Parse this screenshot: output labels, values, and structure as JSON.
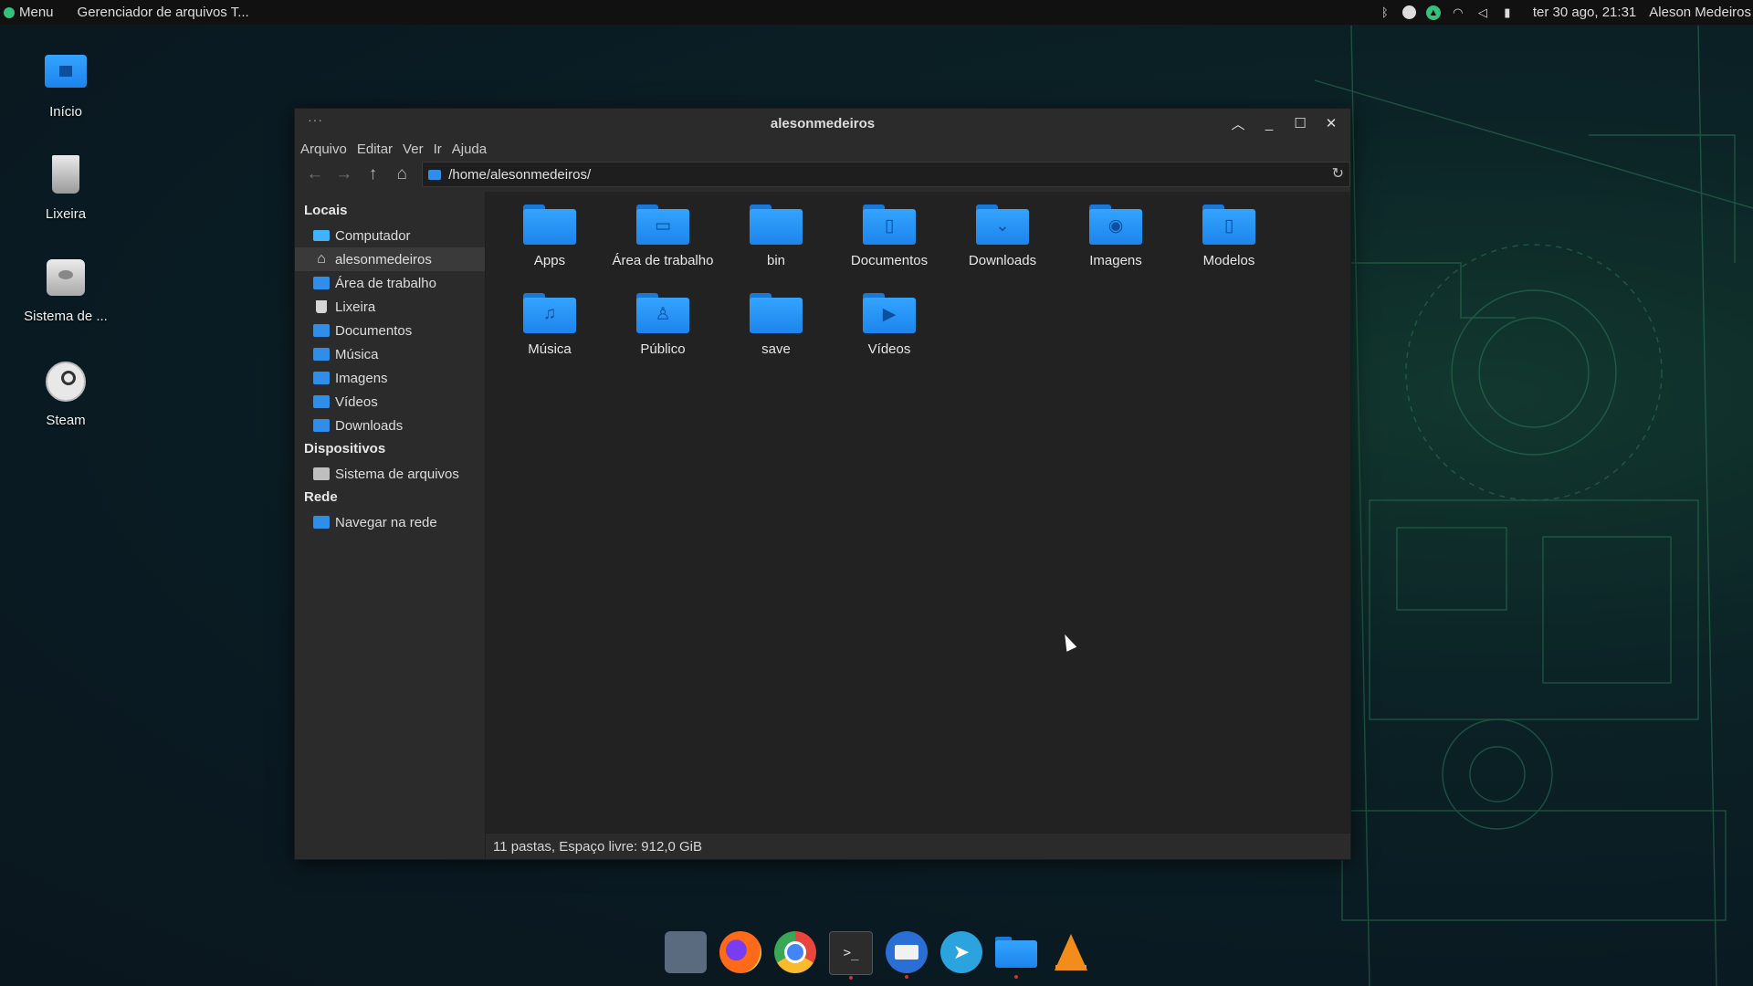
{
  "top_panel": {
    "menu_label": "Menu",
    "task_label": "Gerenciador de arquivos T...",
    "clock": "ter 30 ago, 21:31",
    "user": "Aleson Medeiros",
    "tray_icons": [
      "bluetooth-icon",
      "steam-tray-icon",
      "update-icon",
      "wifi-icon",
      "volume-icon",
      "battery-icon"
    ]
  },
  "desktop": {
    "icons": [
      {
        "label": "Início",
        "icon": "home-folder-icon"
      },
      {
        "label": "Lixeira",
        "icon": "trash-icon"
      },
      {
        "label": "Sistema de ...",
        "icon": "drive-icon"
      },
      {
        "label": "Steam",
        "icon": "steam-icon"
      }
    ]
  },
  "window": {
    "title": "alesonmedeiros",
    "menu": [
      "Arquivo",
      "Editar",
      "Ver",
      "Ir",
      "Ajuda"
    ],
    "location": "/home/alesonmedeiros/",
    "sidebar": {
      "sections": [
        {
          "title": "Locais",
          "items": [
            {
              "label": "Computador",
              "icon": "computer-icon"
            },
            {
              "label": "alesonmedeiros",
              "icon": "home-icon",
              "active": true
            },
            {
              "label": "Área de trabalho",
              "icon": "folder-icon"
            },
            {
              "label": "Lixeira",
              "icon": "trash-icon"
            },
            {
              "label": "Documentos",
              "icon": "folder-icon"
            },
            {
              "label": "Música",
              "icon": "folder-icon"
            },
            {
              "label": "Imagens",
              "icon": "folder-icon"
            },
            {
              "label": "Vídeos",
              "icon": "folder-icon"
            },
            {
              "label": "Downloads",
              "icon": "folder-icon"
            }
          ]
        },
        {
          "title": "Dispositivos",
          "items": [
            {
              "label": "Sistema de arquivos",
              "icon": "drive-icon"
            }
          ]
        },
        {
          "title": "Rede",
          "items": [
            {
              "label": "Navegar na rede",
              "icon": "network-folder-icon"
            }
          ]
        }
      ]
    },
    "files": [
      {
        "name": "Apps",
        "emblem": ""
      },
      {
        "name": "Área de trabalho",
        "emblem": "▭"
      },
      {
        "name": "bin",
        "emblem": ""
      },
      {
        "name": "Documentos",
        "emblem": "▯"
      },
      {
        "name": "Downloads",
        "emblem": "⌄"
      },
      {
        "name": "Imagens",
        "emblem": "◉"
      },
      {
        "name": "Modelos",
        "emblem": "▯"
      },
      {
        "name": "Música",
        "emblem": "♫"
      },
      {
        "name": "Público",
        "emblem": "♙"
      },
      {
        "name": "save",
        "emblem": ""
      },
      {
        "name": "Vídeos",
        "emblem": "▶"
      }
    ],
    "status": "11 pastas, Espaço livre: 912,0 GiB"
  },
  "dock": {
    "items": [
      {
        "name": "network-settings-icon"
      },
      {
        "name": "firefox-icon"
      },
      {
        "name": "chrome-icon"
      },
      {
        "name": "terminal-icon",
        "glyph": ">_"
      },
      {
        "name": "thunderbird-icon"
      },
      {
        "name": "telegram-icon",
        "glyph": "➤"
      },
      {
        "name": "files-icon"
      },
      {
        "name": "vlc-icon"
      }
    ]
  },
  "colors": {
    "accent": "#2f8fe8",
    "panel": "#111111",
    "window_bg": "#2b2b2b",
    "content_bg": "#222222"
  }
}
